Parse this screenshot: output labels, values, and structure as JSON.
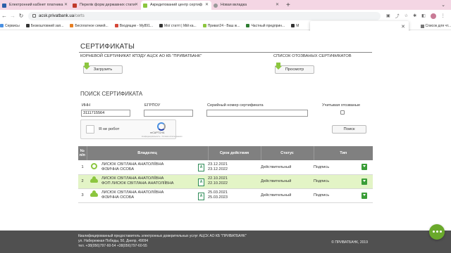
{
  "colors": {
    "tabstrip": "#f4d6e4",
    "accent_green": "#8cc63f",
    "table_header": "#808080",
    "row_highlight": "#e3f4c6",
    "footer": "#505050",
    "chat_button": "#6aa92b"
  },
  "browser": {
    "tabs": [
      {
        "label": "Електронний кабінет платника",
        "favicon": "tax-office-icon",
        "fav_color": "#2b5fa8"
      },
      {
        "label": "Перелік форм державних стати",
        "favicon": "doc-icon",
        "fav_color": "#c0392b"
      },
      {
        "label": "Акредитований центр сертиф",
        "favicon": "privat-icon",
        "fav_color": "#8cc63f",
        "active": true
      },
      {
        "label": "Новая вкладка",
        "favicon": "chrome-icon",
        "fav_color": "#999999"
      }
    ],
    "url_host": "acsk.privatbank.ua",
    "url_path": "/certs",
    "bookmarks": [
      {
        "label": "Сервисы",
        "color": "#4a90e2"
      },
      {
        "label": "Безкоштовний зап...",
        "color": "#333333"
      },
      {
        "label": "Бесплатное семей...",
        "color": "#e67e22"
      },
      {
        "label": "Входящие - My891...",
        "color": "#d44638"
      },
      {
        "label": "Мої статті | Мій ка...",
        "color": "#333333"
      },
      {
        "label": "Приват24 - Ваш ж...",
        "color": "#8cc63f"
      },
      {
        "label": "Частный предприн...",
        "color": "#2e7d32"
      },
      {
        "label": "M",
        "color": "#333333"
      }
    ],
    "bookmark_reading_list": "Список для чт..."
  },
  "page": {
    "title": "СЕРТИФИКАТЫ",
    "root_cert_label": "КОРНЕВОЙ СЕРТИФИКАТ КПЭДУ АЦСК АО КБ \"ПРИВАТБАНК\"",
    "revoked_list_label": "СПИСОК ОТОЗВАНЫХ СЕРТИФИКАТОВ",
    "download_button": "Загрузить",
    "view_button": "Просмотр",
    "search_title": "ПОИСК СЕРТИФИКАТА",
    "inn_label": "ИНН",
    "inn_value": "3111715564",
    "egrpou_label": "ЕГРПОУ",
    "egrpou_value": "",
    "serial_label": "Серийный номер сертификата",
    "serial_value": "",
    "revoked_toggle_label": "Учитывая отозваные",
    "captcha_text": "Я не робот",
    "captcha_brand": "reCAPTCHA",
    "captcha_links": "Конфиденциальность - Условия использования",
    "search_button": "Поиск",
    "table_headers": {
      "num": "№ п/п",
      "owner": "Владелец",
      "term": "Срок действия",
      "status": "Статус",
      "type": "Тип"
    },
    "rows": [
      {
        "num": "1",
        "icon": "key-icon",
        "owner_line1": "ЛИСЮК СВІТЛАНА АНАТОЛІЇВНА",
        "owner_line2": "ФІЗИЧНА ОСОБА",
        "from": "23.12.2021",
        "to": "23.12.2022",
        "status": "Действительный",
        "type": "Подпись"
      },
      {
        "num": "2",
        "icon": "cloud-icon",
        "owner_line1": "ЛИСЮК СВІТЛАНА АНАТОЛІЇВНА",
        "owner_line2": "ФОП ЛИСЮК СВІТЛАНА АНАТОЛІЇВНА",
        "from": "22.10.2021",
        "to": "22.10.2022",
        "status": "Действительный",
        "type": "Подпись",
        "highlight": true
      },
      {
        "num": "3",
        "icon": "cloud-icon",
        "owner_line1": "ЛИСЮК СВІТЛАНА АНАТОЛІЇВНА",
        "owner_line2": "ФІЗИЧНА ОСОБА",
        "from": "25.03.2021",
        "to": "25.03.2023",
        "status": "Действительный",
        "type": "Подпись"
      }
    ],
    "footer_line1": "Квалифицированный предоставитель электронных доверительных услуг АЦСК АО КБ \"ПРИВАТБАНК\"",
    "footer_line2": "ул. Набережная Победы, 50, Днепр, 49094",
    "footer_line3": "тел. +38(056)797-60-54 +38(056)797-60-55",
    "copyright": "© ПРИВАТБАНК, 2019"
  }
}
